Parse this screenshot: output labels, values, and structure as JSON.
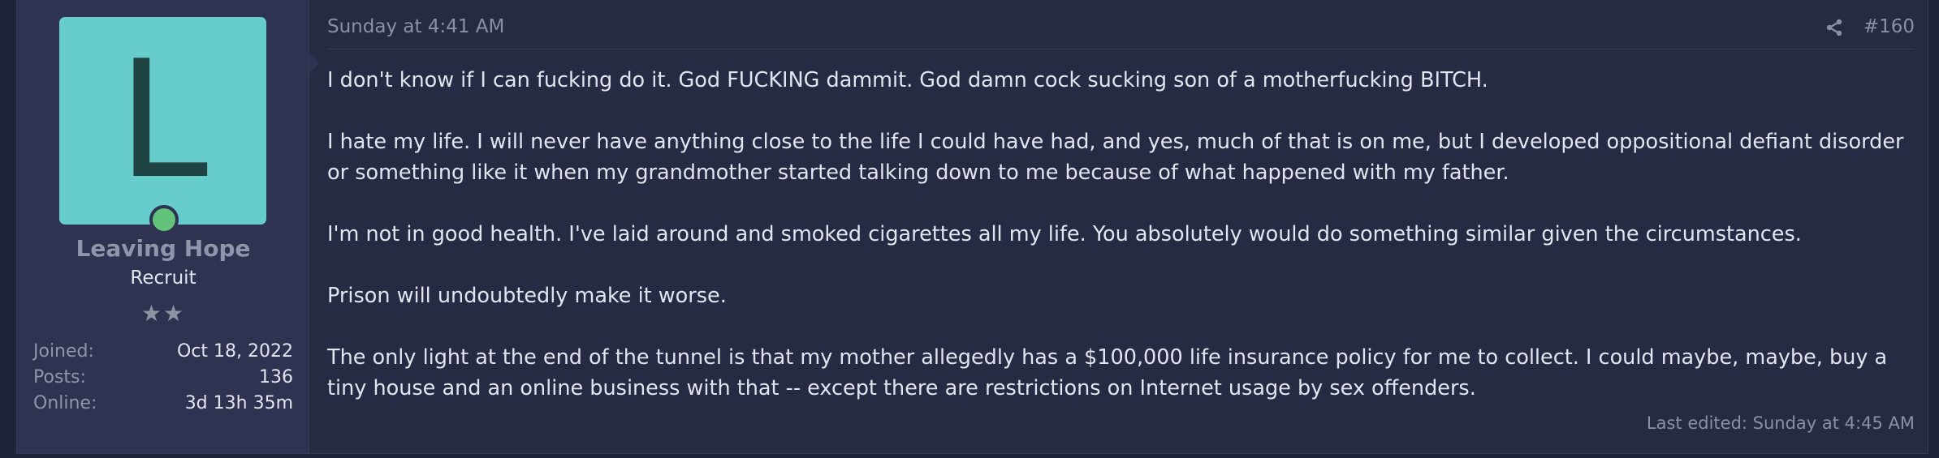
{
  "user": {
    "avatar_letter": "L",
    "name": "Leaving Hope",
    "title": "Recruit",
    "stars": "★★",
    "stats": [
      {
        "label": "Joined:",
        "value": "Oct 18, 2022"
      },
      {
        "label": "Posts:",
        "value": "136"
      },
      {
        "label": "Online:",
        "value": "3d 13h 35m"
      }
    ],
    "online_status_color": "#63c37a",
    "avatar_color": "#66cccc"
  },
  "post": {
    "date": "Sunday at 4:41 AM",
    "number": "#160",
    "share_icon": "share-icon",
    "paragraphs": [
      "I don't know if I can fucking do it. God FUCKING dammit. God damn cock sucking son of a motherfucking BITCH.",
      "I hate my life. I will never have anything close to the life I could have had, and yes, much of that is on me, but I developed oppositional defiant disorder or something like it when my grandmother started talking down to me because of what happened with my father.",
      "I'm not in good health. I've laid around and smoked cigarettes all my life. You absolutely would do something similar given the circumstances.",
      "Prison will undoubtedly make it worse.",
      "The only light at the end of the tunnel is that my mother allegedly has a $100,000 life insurance policy for me to collect. I could maybe, maybe, buy a tiny house and an online business with that -- except there are restrictions on Internet usage by sex offenders."
    ],
    "last_edited": "Last edited: Sunday at 4:45 AM"
  }
}
